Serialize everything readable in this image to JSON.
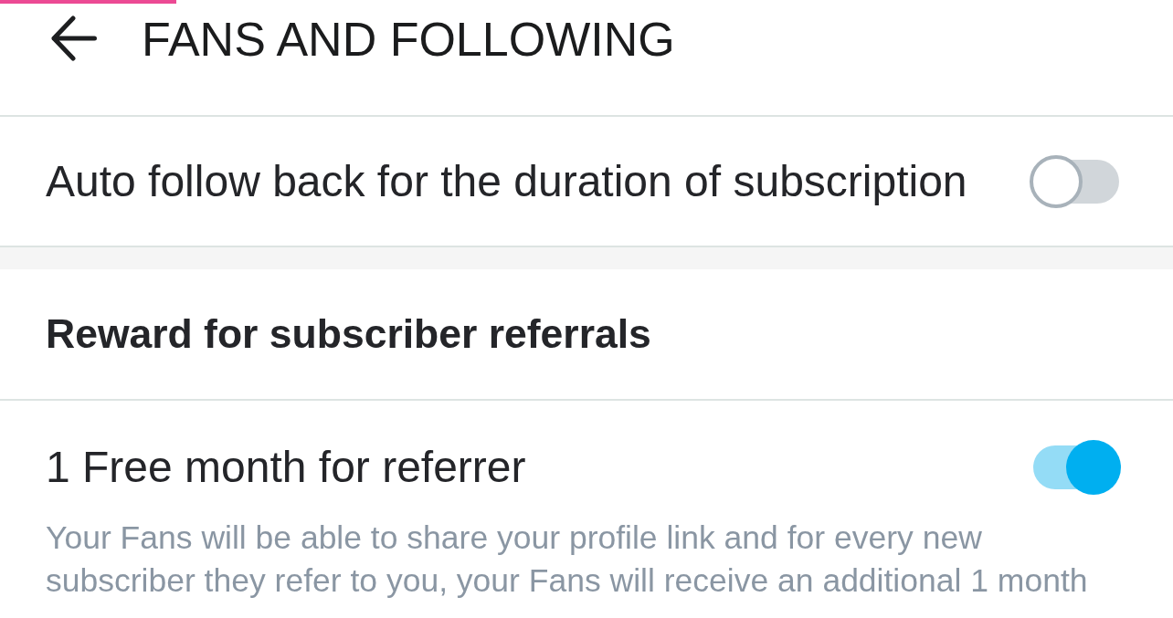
{
  "loading_bar": {
    "level": 0.15
  },
  "header": {
    "title": "FANS AND FOLLOWING"
  },
  "groups": [
    {
      "items": [
        {
          "label": "Auto follow back for the duration of subscription",
          "on": false
        }
      ]
    },
    {
      "heading": "Reward for subscriber referrals",
      "items": [
        {
          "label": "1 Free month for referrer",
          "on": true,
          "description": "Your Fans will be able to share your profile link and for every new subscriber they refer to you, your Fans will receive an additional 1 month"
        }
      ]
    }
  ]
}
